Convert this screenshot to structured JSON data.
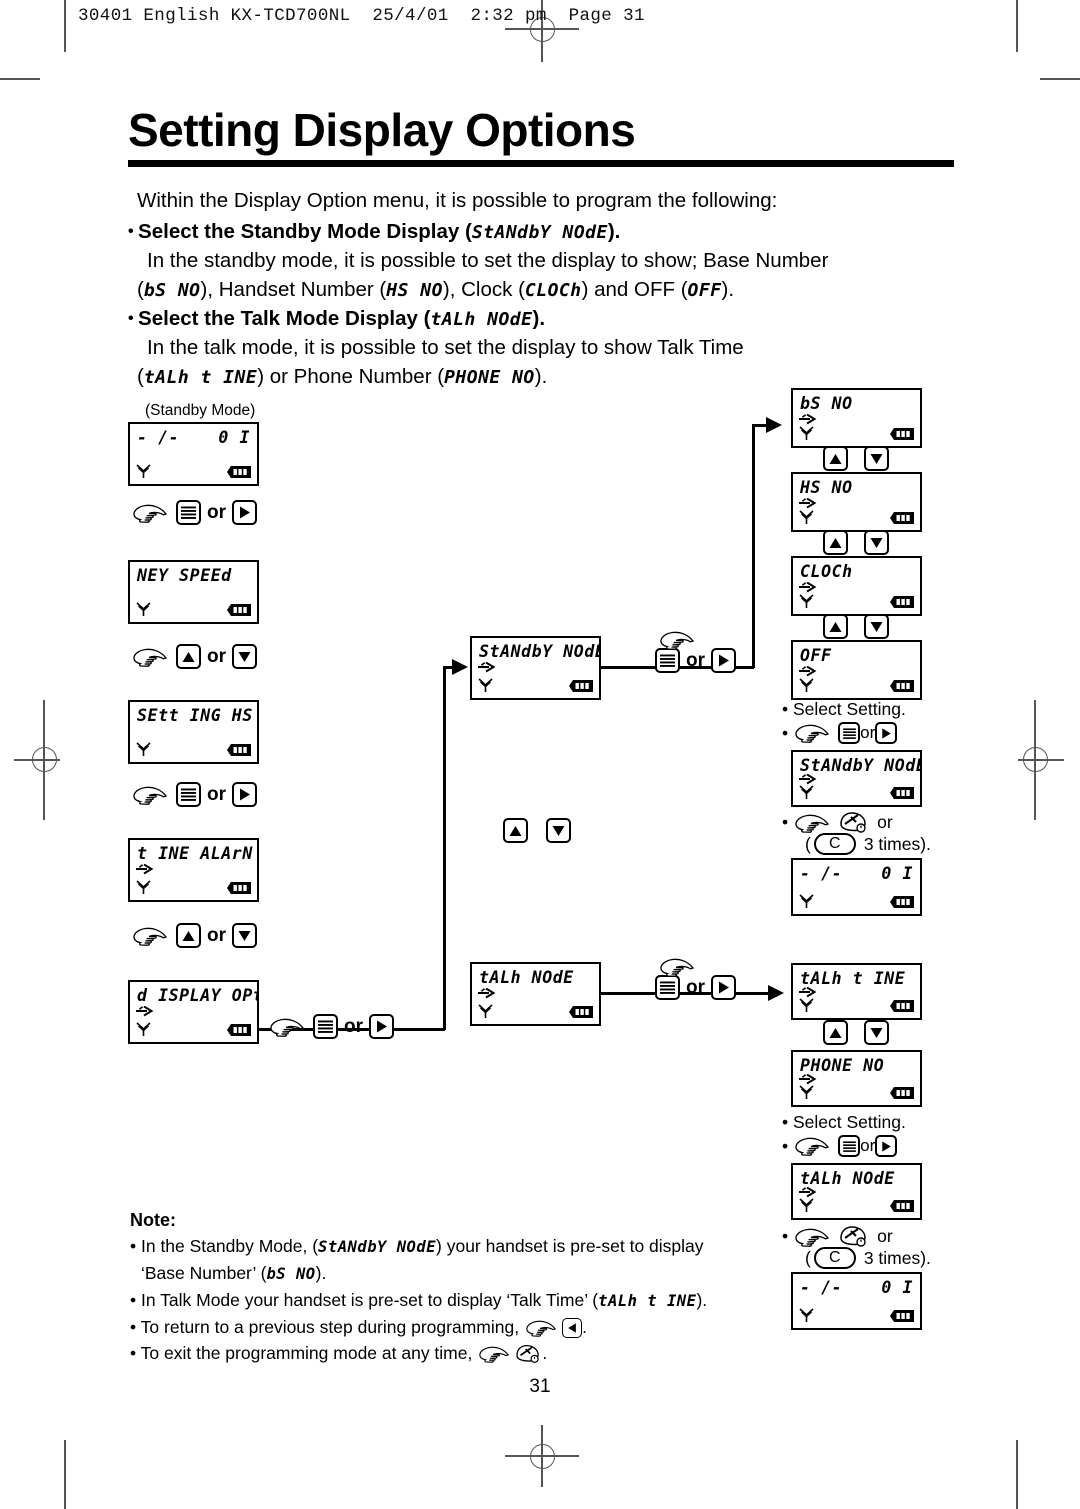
{
  "print_header": "30401 English KX-TCD700NL  25/4/01  2:32 pm  Page 31",
  "page_number": "31",
  "title": "Setting Display Options",
  "intro": {
    "lead": "Within the Display Option menu, it is possible to program the following:",
    "bullet1_bold": "Select the Standby Mode Display (",
    "bullet1_code": "StANdbY NOdE",
    "bullet1_bold_tail": ").",
    "bullet1_line2": "In the standby mode, it is possible to set the display to show; Base Number",
    "b1_l3_p1": "(",
    "b1_l3_c1": "bS NO",
    "b1_l3_p2": "), Handset Number (",
    "b1_l3_c2": "HS NO",
    "b1_l3_p3": "), Clock (",
    "b1_l3_c3": "CLOCh",
    "b1_l3_p4": ") and OFF (",
    "b1_l3_c4": "OFF",
    "b1_l3_p5": ").",
    "bullet2_bold": "Select the Talk Mode Display (",
    "bullet2_code": "tALh NOdE",
    "bullet2_bold_tail": ").",
    "bullet2_line2": "In the talk mode, it is possible to set the display to show Talk Time",
    "b2_l3_p1": "(",
    "b2_l3_c1": "tALh t INE",
    "b2_l3_p2": ") or Phone Number (",
    "b2_l3_c2": "PHONE NO",
    "b2_l3_p3": ")."
  },
  "labels": {
    "standby_mode_caption": "(Standby Mode)",
    "or": "or",
    "select_setting": "• Select Setting.",
    "bullet": "•",
    "c_key": "C",
    "three_times_open": "(",
    "three_times": "3 times).",
    "or_plain": "or"
  },
  "left_column": {
    "step1": {
      "main": "- /-",
      "right": "0 I",
      "arrow": false
    },
    "step2": {
      "main": "NEY SPEEd",
      "right": "",
      "arrow": false
    },
    "step3": {
      "main": "SEtt ING HS",
      "right": "",
      "arrow": false
    },
    "step4": {
      "main": "t INE ALArN",
      "right": "",
      "arrow": true
    },
    "step5": {
      "main": "d ISPLAY OPt",
      "right": "",
      "arrow": true
    },
    "key1": "menu-or-right",
    "key2": "up-or-down",
    "key3": "menu-or-right",
    "key4": "up-or-down",
    "key5": "menu-or-right"
  },
  "middle_column": {
    "standby": {
      "main": "StANdbY NOdE",
      "right": "",
      "arrow": true
    },
    "talk": {
      "main": "tALh NOdE",
      "right": "",
      "arrow": true
    },
    "key_updown": "up-or-down",
    "key_standby": "menu-or-right",
    "key_talk": "menu-or-right"
  },
  "right_column": {
    "standby_options": [
      {
        "main": "bS NO",
        "right": "",
        "arrow": true
      },
      {
        "main": "HS NO",
        "right": "",
        "arrow": true
      },
      {
        "main": "CLOCh",
        "right": "",
        "arrow": true
      },
      {
        "main": "OFF",
        "right": "",
        "arrow": true
      }
    ],
    "standby_confirm": {
      "main": "StANdbY NOdE",
      "right": "",
      "arrow": true
    },
    "standby_final": {
      "main": "- /-",
      "right": "0 I",
      "arrow": false
    },
    "talk_options": [
      {
        "main": "tALh t INE",
        "right": "",
        "arrow": true
      },
      {
        "main": "PHONE NO",
        "right": "",
        "arrow": true
      }
    ],
    "talk_confirm": {
      "main": "tALh NOdE",
      "right": "",
      "arrow": true
    },
    "talk_final": {
      "main": "- /-",
      "right": "0 I",
      "arrow": false
    }
  },
  "note": {
    "header": "Note:",
    "n1_p1": "• In the Standby Mode, (",
    "n1_c1": "StANdbY  NOdE",
    "n1_p2": ") your handset is pre-set to display",
    "n1_l2_p1": "‘Base Number’ (",
    "n1_l2_c1": "bS NO",
    "n1_l2_p2": ").",
    "n2_p1": "• In Talk Mode your handset is pre-set to display ‘Talk Time’ (",
    "n2_c1": "tALh t INE",
    "n2_p2": ").",
    "n3_p1": "• To return to a previous step during programming,",
    "n3_p2": ".",
    "n4_p1": "• To exit the programming mode at any time,",
    "n4_p2": "."
  },
  "icons": {
    "hand": "pointing-hand-icon",
    "menu": "menu-button-icon",
    "right": "right-arrow-button-icon",
    "up": "up-arrow-button-icon",
    "down": "down-arrow-button-icon",
    "left": "left-arrow-button-icon",
    "off": "phone-off-icon",
    "antenna": "antenna-icon",
    "battery": "battery-icon",
    "indicator": "right-indicator-arrow-icon"
  },
  "colors": {
    "ink": "#000000",
    "paper": "#ffffff",
    "mark": "#555555"
  }
}
